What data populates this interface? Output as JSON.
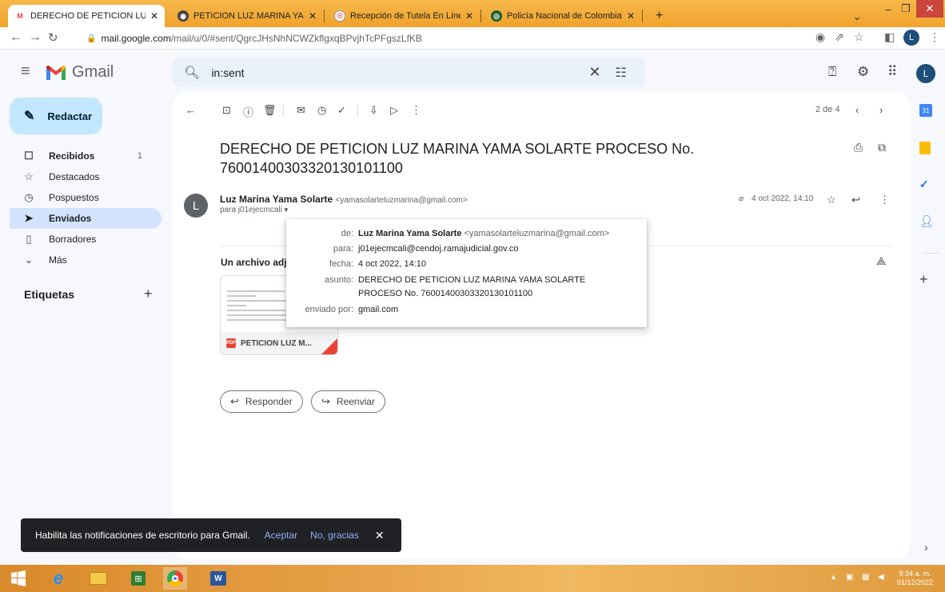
{
  "browser": {
    "tabs": [
      {
        "title": "DERECHO DE PETICION LUZ MAR",
        "active": true
      },
      {
        "title": "PETICION LUZ MARINA YAMA S(",
        "active": false
      },
      {
        "title": "Recepción de Tutela En Línea",
        "active": false
      },
      {
        "title": "Policía Nacional de Colombia",
        "active": false
      }
    ],
    "new_tab": "+",
    "url_host": "mail.google.com",
    "url_path": "/mail/u/0/#sent/QgrcJHsNhNCWZkflgxqBPvjhTcPFgszLfKB",
    "profile_initial": "L"
  },
  "gmail": {
    "brand": "Gmail",
    "search_value": "in:sent",
    "avatar_initial": "L",
    "compose_label": "Redactar",
    "nav": [
      {
        "label": "Recibidos",
        "icon": "inbox-icon",
        "glyph": "☐",
        "count": "1",
        "bold": true
      },
      {
        "label": "Destacados",
        "icon": "star-icon",
        "glyph": "☆",
        "count": "",
        "bold": false
      },
      {
        "label": "Pospuestos",
        "icon": "clock-icon",
        "glyph": "◷",
        "count": "",
        "bold": false
      },
      {
        "label": "Enviados",
        "icon": "send-icon",
        "glyph": "➤",
        "count": "",
        "bold": true,
        "active": true
      },
      {
        "label": "Borradores",
        "icon": "draft-icon",
        "glyph": "🗋",
        "count": "",
        "bold": false
      },
      {
        "label": "Más",
        "icon": "chevron-down-icon",
        "glyph": "⌄",
        "count": "",
        "bold": false
      }
    ],
    "labels_heading": "Etiquetas",
    "pager": "2 de 4",
    "subject": "DERECHO DE PETICION LUZ MARINA YAMA SOLARTE PROCESO No. 76001400303320130101100",
    "sender_initial": "L",
    "sender_name": "Luz Marina Yama Solarte",
    "sender_email": "<yamasolarteluzmarina@gmail.com>",
    "to_line": "para j01ejecmcali",
    "date_short": "4 oct 2022, 14:10",
    "attachments_title": "Un archivo adjunto",
    "attachment_name": "PETICION LUZ M...",
    "pdf_badge": "PDF",
    "reply_label": "Responder",
    "forward_label": "Reenviar",
    "details": {
      "from_label": "de:",
      "from_name": "Luz Marina Yama Solarte",
      "from_email": "<yamasolarteluzmarina@gmail.com>",
      "to_label": "para:",
      "to_value": "j01ejecmcali@cendoj.ramajudicial.gov.co",
      "date_label": "fecha:",
      "date_value": "4 oct 2022, 14:10",
      "subject_label": "asunto:",
      "subject_line1": "DERECHO DE PETICION LUZ MARINA YAMA SOLARTE",
      "subject_line2": "PROCESO No. 76001400303320130101100",
      "mailedby_label": "enviado por:",
      "mailedby_value": "gmail.com"
    },
    "snackbar": {
      "message": "Habilita las notificaciones de escritorio para Gmail.",
      "accept": "Aceptar",
      "decline": "No, gracias"
    }
  },
  "taskbar": {
    "time": "9:34 a. m.",
    "date": "01/12/2022"
  },
  "colors": {
    "compose": "#c2e7ff",
    "active_nav": "#d3e3fd",
    "search_bg": "#eaf1fb",
    "link_blue": "#8ab4f8"
  }
}
